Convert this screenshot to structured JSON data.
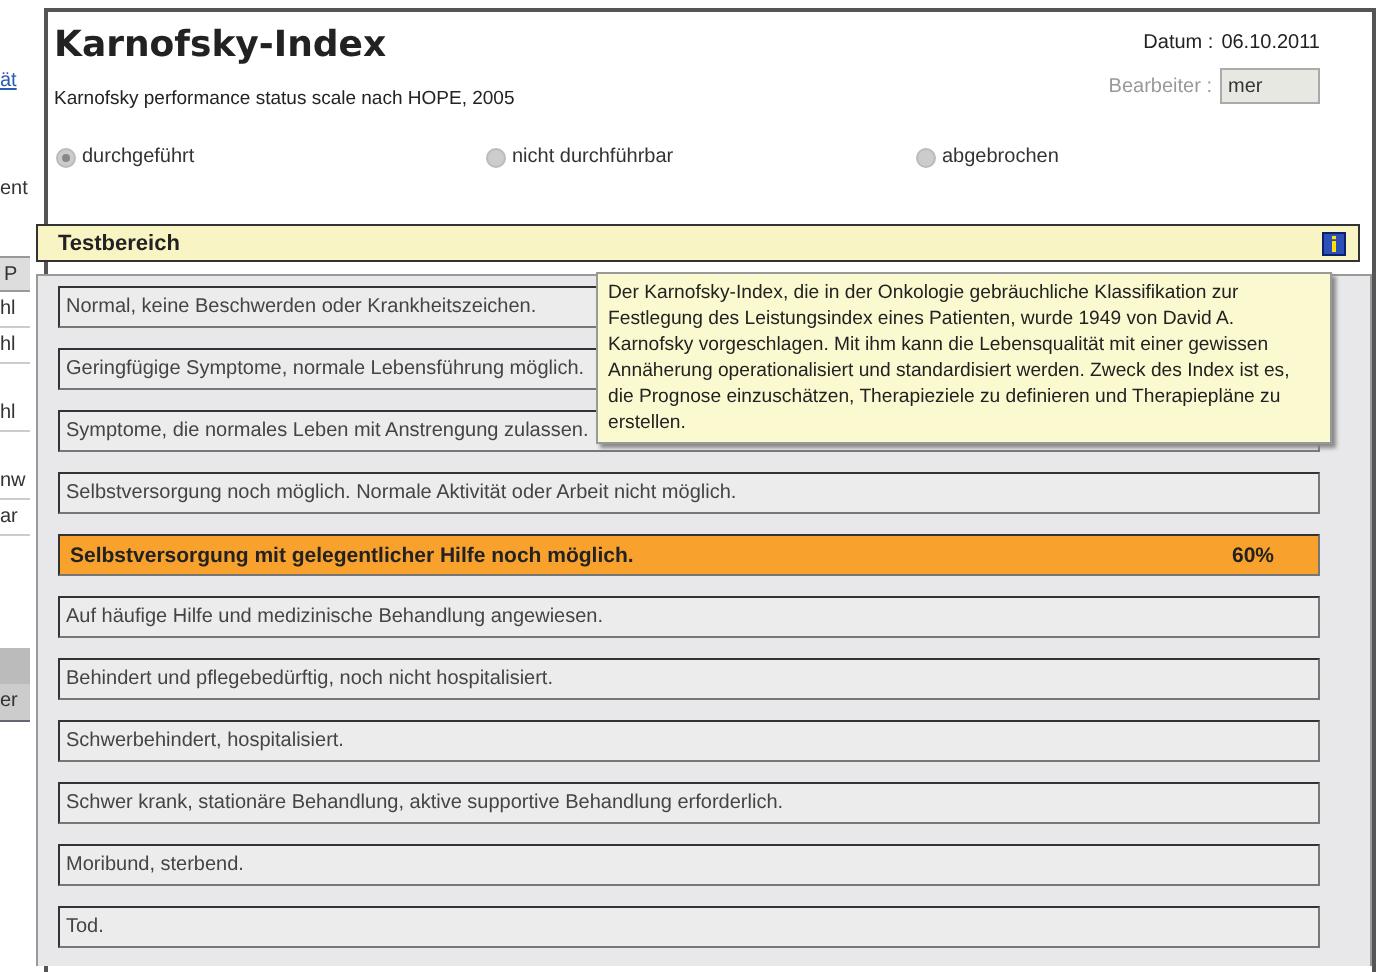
{
  "background_window": {
    "fragments": [
      {
        "kind": "link",
        "text": "ät"
      },
      {
        "kind": "text",
        "text": "ent"
      },
      {
        "kind": "header",
        "text": "P"
      },
      {
        "kind": "cell",
        "text": "hl"
      },
      {
        "kind": "cell",
        "text": "hl"
      },
      {
        "kind": "cell",
        "text": "hl"
      },
      {
        "kind": "cell",
        "text": "nw"
      },
      {
        "kind": "cell",
        "text": "ar"
      },
      {
        "kind": "tab",
        "text": "er"
      }
    ]
  },
  "dialog": {
    "title": "Karnofsky-Index",
    "subtitle": "Karnofsky performance status scale nach HOPE, 2005",
    "date_label": "Datum :",
    "date": "06.10.2011",
    "editor": {
      "label": "Bearbeiter :",
      "value": "mer",
      "disabled": true
    },
    "status_options": [
      {
        "label": "durchgeführt",
        "selected": true
      },
      {
        "label": "nicht durchführbar",
        "selected": false
      },
      {
        "label": "abgebrochen",
        "selected": false
      }
    ],
    "section_title": "Testbereich",
    "tooltip": "Der Karnofsky-Index, die in der Onkologie gebräuchliche Klassifikation zur Festlegung des Leistungsindex eines Patienten, wurde 1949 von David A. Karnofsky vorgeschlagen. Mit ihm kann die Lebensqualität mit einer gewissen Annäherung operationalisiert und standardisiert werden. Zweck des Index ist es, die Prognose einzuschätzen, Therapieziele zu definieren und Therapiepläne zu erstellen.",
    "levels": [
      {
        "label": "Normal, keine Beschwerden oder Krankheitszeichen.",
        "selected": false
      },
      {
        "label": "Geringfügige Symptome, normale Lebensführung möglich.",
        "selected": false
      },
      {
        "label": "Symptome, die normales Leben mit Anstrengung zulassen.",
        "selected": false
      },
      {
        "label": "Selbstversorgung noch möglich. Normale Aktivität oder Arbeit nicht möglich.",
        "selected": false
      },
      {
        "label": "Selbstversorgung mit gelegentlicher Hilfe noch möglich.",
        "selected": true,
        "score": "60%"
      },
      {
        "label": "Auf häufige Hilfe und medizinische Behandlung angewiesen.",
        "selected": false
      },
      {
        "label": "Behindert und pflegebedürftig, noch nicht hospitalisiert.",
        "selected": false
      },
      {
        "label": "Schwerbehindert, hospitalisiert.",
        "selected": false
      },
      {
        "label": "Schwer krank, stationäre Behandlung, aktive supportive Behandlung erforderlich.",
        "selected": false
      },
      {
        "label": "Moribund, sterbend.",
        "selected": false
      },
      {
        "label": "Tod.",
        "selected": false
      }
    ]
  }
}
